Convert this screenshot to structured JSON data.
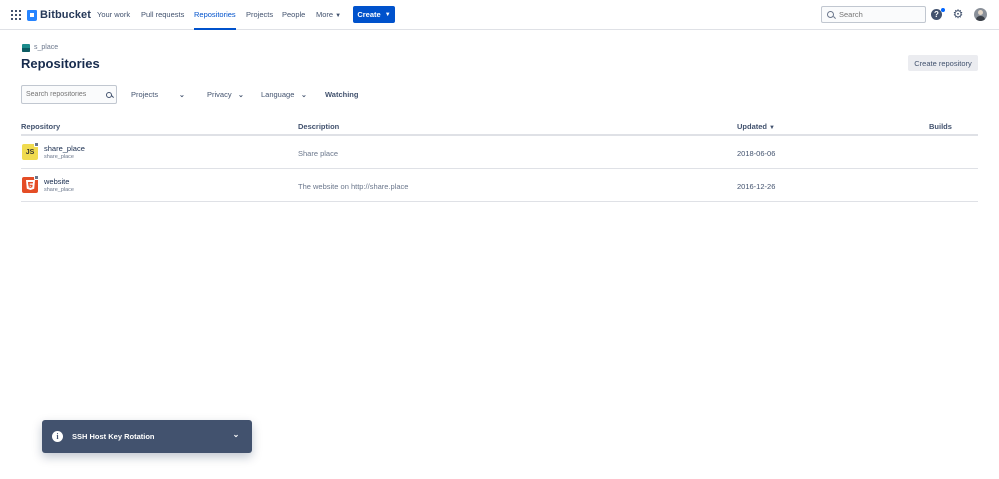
{
  "app": {
    "name": "Bitbucket",
    "brand_color": "#0052cc"
  },
  "topnav": {
    "links": [
      {
        "label": "Your work"
      },
      {
        "label": "Pull requests"
      },
      {
        "label": "Repositories",
        "active": true
      },
      {
        "label": "Projects"
      },
      {
        "label": "People"
      },
      {
        "label": "More"
      }
    ],
    "create_label": "Create",
    "search_placeholder": "Search",
    "icons": [
      "apps-grid-icon",
      "bitbucket-logo-icon",
      "help-icon",
      "settings-gear-icon",
      "user-avatar"
    ]
  },
  "header": {
    "workspace": "s_place",
    "title": "Repositories",
    "create_repo_label": "Create repository"
  },
  "filters": {
    "search_placeholder": "Search repositories",
    "projects_label": "Projects",
    "privacy_label": "Privacy",
    "language_label": "Language",
    "watching_label": "Watching"
  },
  "table": {
    "columns": [
      "Repository",
      "Description",
      "Updated",
      "Builds"
    ],
    "sorted_column": "Updated",
    "rows": [
      {
        "name": "share_place",
        "workspace": "share_place",
        "language_icon": "JS",
        "description": "Share place",
        "updated": "2018-06-06",
        "builds": ""
      },
      {
        "name": "website",
        "workspace": "share_place",
        "language_icon": "html5-icon",
        "description": "The website on http://share.place",
        "updated": "2016-12-26",
        "builds": ""
      }
    ]
  },
  "flag": {
    "title": "SSH Host Key Rotation"
  }
}
